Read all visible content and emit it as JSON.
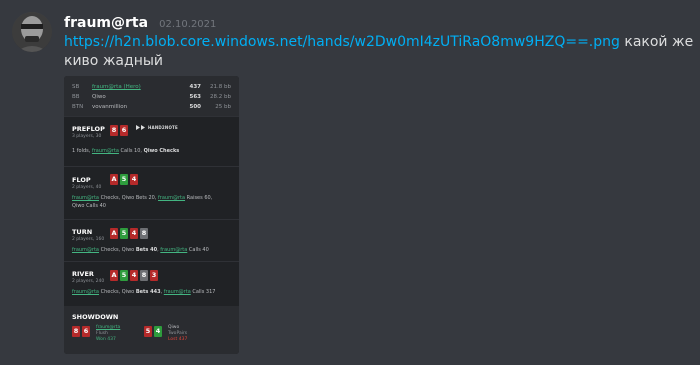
{
  "message": {
    "username": "fraum@rta",
    "timestamp": "02.10.2021",
    "link": "https://h2n.blob.core.windows.net/hands/w2Dw0mI4zUTiRaO8mw9HZQ==.png",
    "text": " какой же киво жадный"
  },
  "hand": {
    "players": [
      {
        "pos": "SB",
        "name": "fraum@rta (Hero)",
        "stack": "437",
        "bb": "21.8 bb"
      },
      {
        "pos": "BB",
        "name": "Qiwo",
        "stack": "563",
        "bb": "28.2 bb"
      },
      {
        "pos": "BTN",
        "name": "vovanmillion",
        "stack": "500",
        "bb": "25 bb"
      }
    ],
    "logo_text": "HAND2NOTE",
    "preflop": {
      "title": "PREFLOP",
      "sub": "3 players, 30",
      "cards": [
        "8",
        "6"
      ],
      "a1": "1 folds, ",
      "a2": "fraum@rta",
      "a3": " Calls 10, ",
      "a4": "Qiwo",
      "a5": " Checks"
    },
    "flop": {
      "title": "FLOP",
      "sub": "2 players, 40",
      "cards": [
        "A",
        "5",
        "4"
      ],
      "l1a": "fraum@rta",
      "l1b": " Checks, Qiwo ",
      "l1c": "Bets 20",
      "l1d": ", ",
      "l1e": "fraum@rta",
      "l1f": " Raises 60,",
      "l2a": "Qiwo ",
      "l2b": "Calls 40"
    },
    "turn": {
      "title": "TURN",
      "sub": "2 players, 160",
      "cards": [
        "A",
        "5",
        "4",
        "8"
      ],
      "a": "fraum@rta",
      "b": " Checks, Qiwo ",
      "c": "Bets 40",
      "d": ", ",
      "e": "fraum@rta",
      "f": " Calls 40"
    },
    "river": {
      "title": "RIVER",
      "sub": "2 players, 240",
      "cards": [
        "A",
        "5",
        "4",
        "8",
        "3"
      ],
      "a": "fraum@rta",
      "b": " Checks, Qiwo ",
      "c": "Bets 443",
      "d": ", ",
      "e": "fraum@rta",
      "f": " Calls 317"
    },
    "showdown": {
      "title": "SHOWDOWN",
      "p1": {
        "cards": [
          "8",
          "6"
        ],
        "name": "fraum@rta",
        "hand": "Flush",
        "result": "Won 437"
      },
      "p2": {
        "cards": [
          "5",
          "4"
        ],
        "name": "Qiwo",
        "hand": "TwoPairs",
        "result": "Lost 437"
      }
    }
  },
  "colors": {
    "red_card": "#b52a2a",
    "green_card": "#2e9c3d",
    "gray_card": "#6d6f73",
    "link": "#00aff4",
    "hero": "#43b581"
  }
}
